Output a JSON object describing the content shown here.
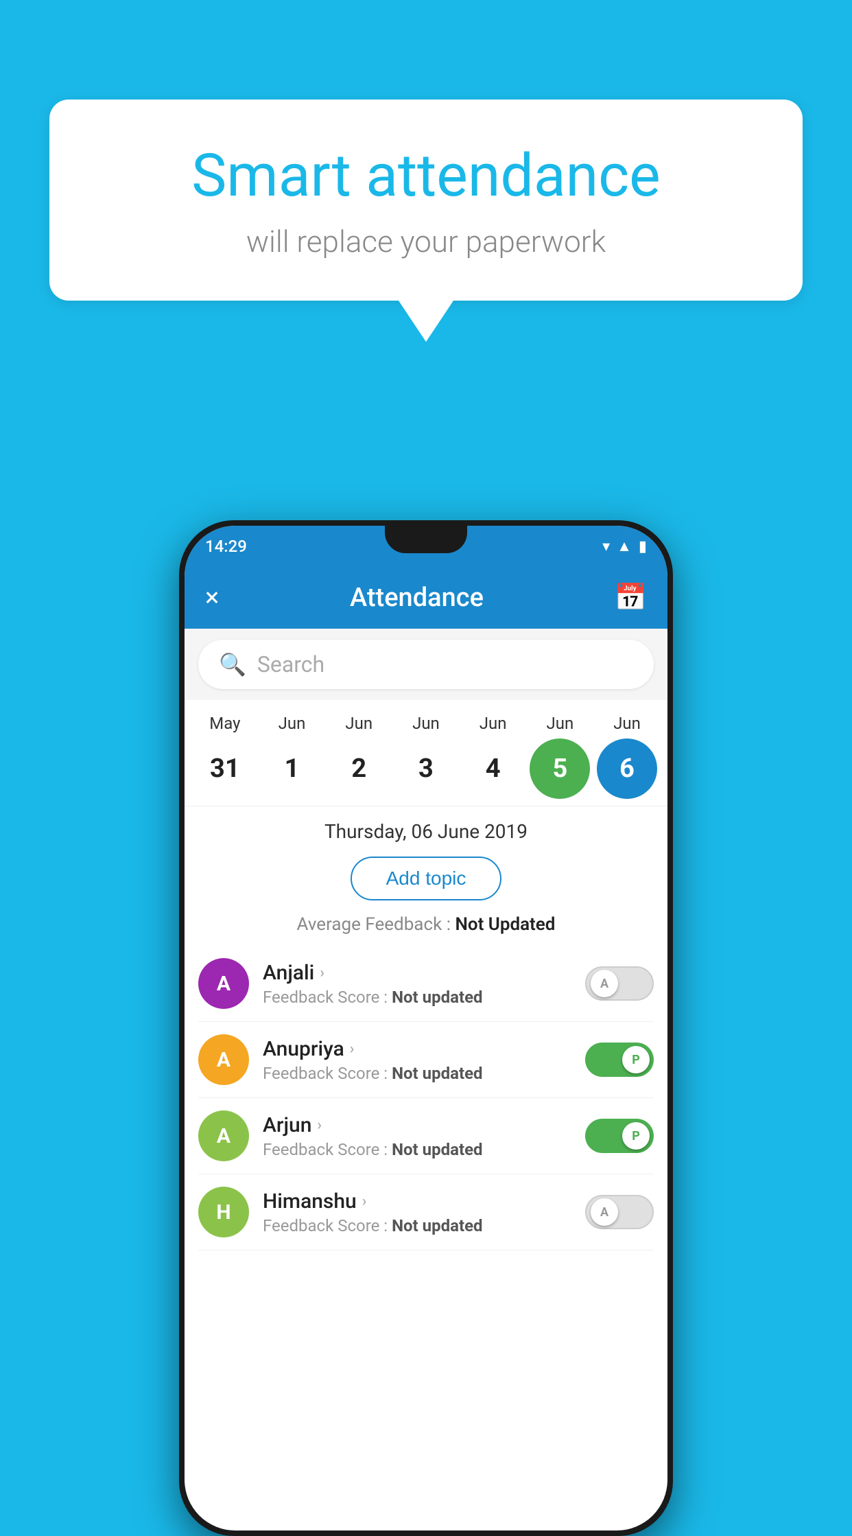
{
  "background_color": "#1ab8e8",
  "speech_bubble": {
    "title": "Smart attendance",
    "subtitle": "will replace your paperwork"
  },
  "phone": {
    "status_bar": {
      "time": "14:29",
      "icons": [
        "wifi",
        "signal",
        "battery"
      ]
    },
    "app_header": {
      "title": "Attendance",
      "close_label": "×",
      "calendar_label": "📅"
    },
    "search": {
      "placeholder": "Search"
    },
    "calendar": {
      "months": [
        "May",
        "Jun",
        "Jun",
        "Jun",
        "Jun",
        "Jun",
        "Jun"
      ],
      "dates": [
        "31",
        "1",
        "2",
        "3",
        "4",
        "5",
        "6"
      ],
      "selected_green": "5",
      "selected_blue": "6"
    },
    "selected_date": "Thursday, 06 June 2019",
    "add_topic_label": "Add topic",
    "avg_feedback_label": "Average Feedback :",
    "avg_feedback_value": "Not Updated",
    "students": [
      {
        "name": "Anjali",
        "avatar_letter": "A",
        "avatar_color": "#9c27b0",
        "feedback_label": "Feedback Score :",
        "feedback_value": "Not updated",
        "toggle_state": "off",
        "toggle_label": "A"
      },
      {
        "name": "Anupriya",
        "avatar_letter": "A",
        "avatar_color": "#f5a623",
        "feedback_label": "Feedback Score :",
        "feedback_value": "Not updated",
        "toggle_state": "on",
        "toggle_label": "P"
      },
      {
        "name": "Arjun",
        "avatar_letter": "A",
        "avatar_color": "#8bc34a",
        "feedback_label": "Feedback Score :",
        "feedback_value": "Not updated",
        "toggle_state": "on",
        "toggle_label": "P"
      },
      {
        "name": "Himanshu",
        "avatar_letter": "H",
        "avatar_color": "#8bc34a",
        "feedback_label": "Feedback Score :",
        "feedback_value": "Not updated",
        "toggle_state": "off",
        "toggle_label": "A"
      }
    ]
  }
}
